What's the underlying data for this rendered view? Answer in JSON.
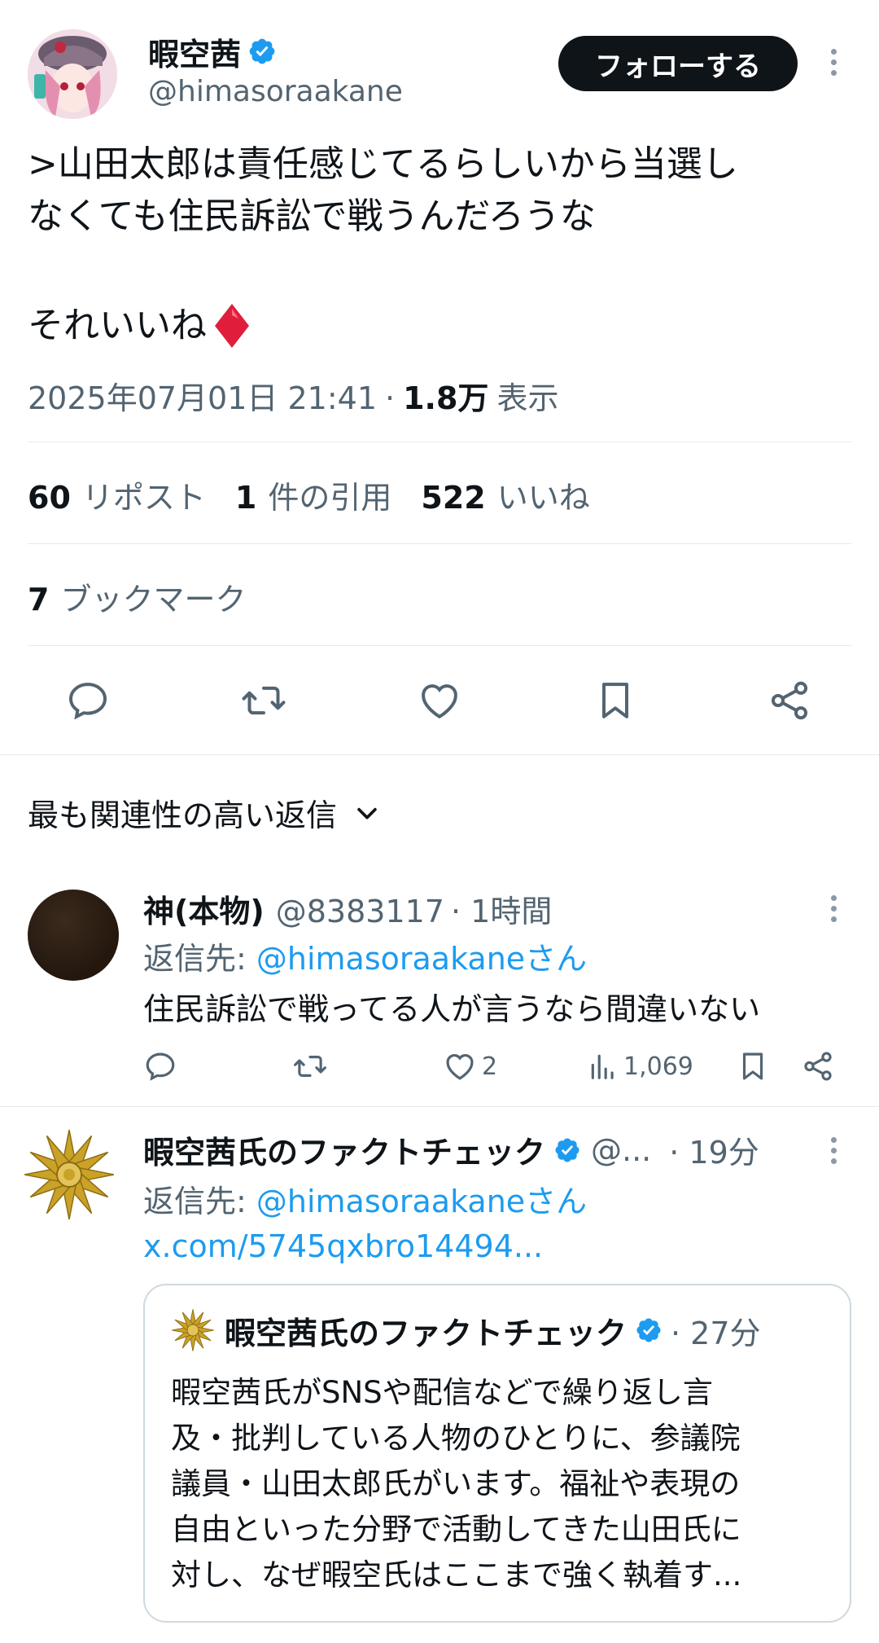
{
  "post": {
    "display_name": "暇空茜",
    "handle": "@himasoraakane",
    "follow_label": "フォローする",
    "text_line1": ">山田太郎は責任感じてるらしいから当選し",
    "text_line2": "なくても住民訴訟で戦うんだろうな",
    "text_line3": "それいいね",
    "emoji": "diamond-red-icon",
    "timestamp": "2025年07月01日 21:41",
    "separator": "·",
    "views": "1.8万",
    "views_label": "表示"
  },
  "stats": {
    "reposts_count": "60",
    "reposts_label": "リポスト",
    "quotes_count": "1",
    "quotes_label": "件の引用",
    "likes_count": "522",
    "likes_label": "いいね",
    "bookmarks_count": "7",
    "bookmarks_label": "ブックマーク"
  },
  "replies_header": {
    "label": "最も関連性の高い返信"
  },
  "replies": [
    {
      "name": "神(本物)",
      "handle": "@8383117",
      "time": "· 1時間",
      "reply_to_prefix": "返信先: ",
      "reply_to": "@himasoraakaneさん",
      "text": "住民訴訟で戦ってる人が言うなら間違いない",
      "likes": "2",
      "views": "1,069"
    },
    {
      "name": "暇空茜氏のファクトチェック",
      "handle": "@...",
      "time": "· 19分",
      "reply_to_prefix": "返信先: ",
      "reply_to": "@himasoraakaneさん",
      "link": "x.com/5745qxbro14494...",
      "quote": {
        "name": "暇空茜氏のファクトチェック",
        "time": "· 27分",
        "line1": "暇空茜氏がSNSや配信などで繰り返し言",
        "line2": "及・批判している人物のひとりに、参議院",
        "line3": "議員・山田太郎氏がいます。福祉や表現の",
        "line4": "自由といった分野で活動してきた山田氏に",
        "line5": "対し、なぜ暇空氏はここまで強く執着す..."
      }
    }
  ],
  "colors": {
    "accent": "#1d9bf0",
    "text": "#0f1419",
    "muted": "#536471",
    "follow_button": "#0f1419"
  }
}
